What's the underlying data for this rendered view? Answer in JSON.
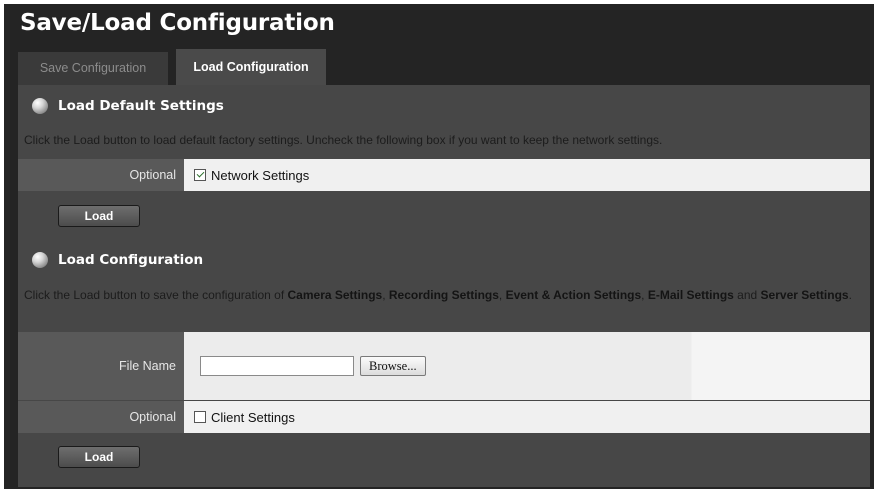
{
  "page": {
    "title": "Save/Load Configuration"
  },
  "tabs": [
    {
      "label": "Save Configuration",
      "active": false
    },
    {
      "label": "Load Configuration",
      "active": true
    }
  ],
  "load_default": {
    "title": "Load Default Settings",
    "description": "Click the Load button to load default factory settings. Uncheck the following box if you want to keep the network settings.",
    "optional_label": "Optional",
    "checkbox_label": "Network Settings",
    "checked": true,
    "button_label": "Load"
  },
  "load_config": {
    "title": "Load Configuration",
    "desc_parts": {
      "p1": "Click the Load button to save the configuration of ",
      "b1": "Camera Settings",
      "p2": ", ",
      "b2": "Recording Settings",
      "p3": ", ",
      "b3": "Event & Action Settings",
      "p4": ", ",
      "b4": "E-Mail Settings",
      "p5": " and ",
      "b5": "Server Settings",
      "p6": "."
    },
    "file_name_label": "File Name",
    "file_name_value": "",
    "browse_label": "Browse...",
    "optional_label": "Optional",
    "checkbox_label": "Client Settings",
    "checked": false,
    "button_label": "Load"
  },
  "colors": {
    "frame_bg": "#242424",
    "panel_bg": "#474747",
    "label_bg": "#595959",
    "value_bg": "#f0f0f0"
  }
}
